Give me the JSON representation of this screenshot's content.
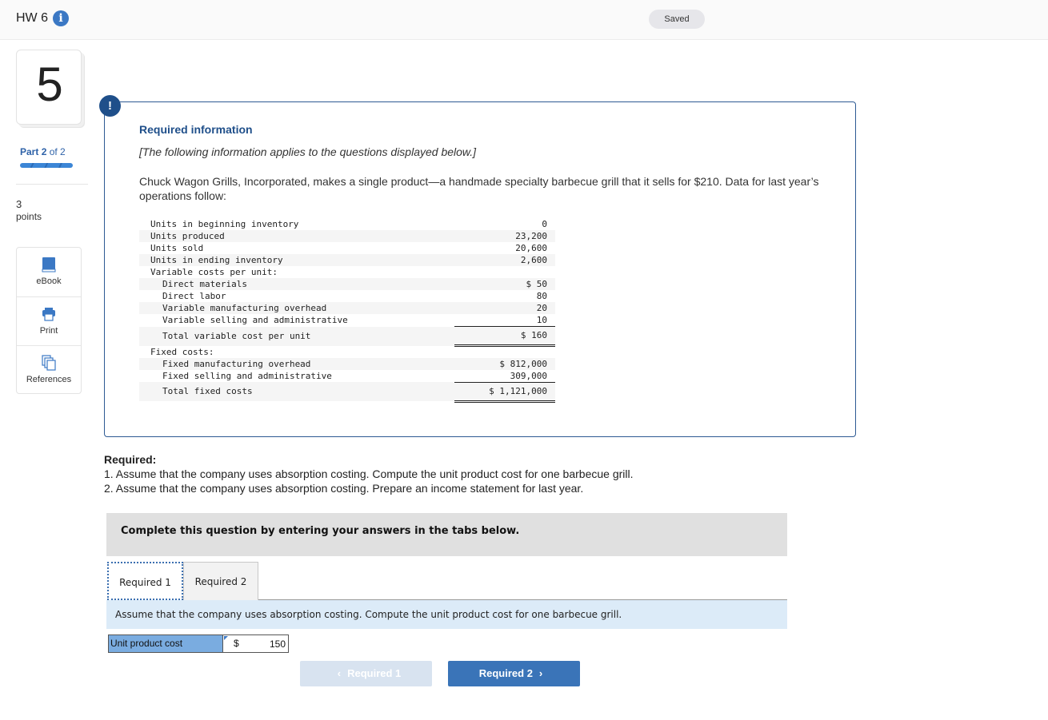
{
  "header": {
    "title": "HW 6",
    "info_icon": "info-circle-icon",
    "status": "Saved"
  },
  "sidebar": {
    "question_number": "5",
    "part_prefix": "Part",
    "part_current": "2",
    "part_suffix": "of 2",
    "progress_fraction": 1.0,
    "points_value": "3",
    "points_label": "points",
    "tools": [
      {
        "label": "eBook",
        "icon": "book-icon"
      },
      {
        "label": "Print",
        "icon": "printer-icon"
      },
      {
        "label": "References",
        "icon": "documents-icon"
      }
    ]
  },
  "required_info": {
    "badge": "!",
    "title": "Required information",
    "note": "[The following information applies to the questions displayed below.]",
    "description": "Chuck Wagon Grills, Incorporated, makes a single product—a handmade specialty barbecue grill that it sells for $210. Data for last year’s operations follow:",
    "rows": [
      {
        "label": "Units in beginning inventory",
        "value": "0"
      },
      {
        "label": "Units produced",
        "value": "23,200"
      },
      {
        "label": "Units sold",
        "value": "20,600"
      },
      {
        "label": "Units in ending inventory",
        "value": "2,600"
      },
      {
        "label": "Variable costs per unit:",
        "value": ""
      },
      {
        "label": "Direct materials",
        "value": "$ 50"
      },
      {
        "label": "Direct labor",
        "value": "80"
      },
      {
        "label": "Variable manufacturing overhead",
        "value": "20"
      },
      {
        "label": "Variable selling and administrative",
        "value": "10"
      },
      {
        "label": "Total variable cost per unit",
        "value": "$ 160"
      },
      {
        "label": "Fixed costs:",
        "value": ""
      },
      {
        "label": "Fixed manufacturing overhead",
        "value": "$ 812,000"
      },
      {
        "label": "Fixed selling and administrative",
        "value": "309,000"
      },
      {
        "label": "Total fixed costs",
        "value": "$ 1,121,000"
      }
    ]
  },
  "required": {
    "heading": "Required:",
    "items": [
      "1. Assume that the company uses absorption costing. Compute the unit product cost for one barbecue grill.",
      "2. Assume that the company uses absorption costing. Prepare an income statement for last year."
    ]
  },
  "question": {
    "instruction_bar": "Complete this question by entering your answers in the tabs below.",
    "tabs": [
      {
        "label": "Required 1",
        "active": true
      },
      {
        "label": "Required 2",
        "active": false
      }
    ],
    "tab_instruction": "Assume that the company uses absorption costing. Compute the unit product cost for one barbecue grill.",
    "answer": {
      "label": "Unit product cost",
      "currency": "$",
      "value": "150"
    },
    "nav": {
      "prev_label": "Required 1",
      "next_label": "Required 2",
      "prev_icon": "chevron-left-icon",
      "next_icon": "chevron-right-icon"
    }
  },
  "colors": {
    "accent": "#3a74b8",
    "alert_navy": "#1f4f8a",
    "answer_label_bg": "#7aace0",
    "instruction_bg": "#dcebf8"
  }
}
